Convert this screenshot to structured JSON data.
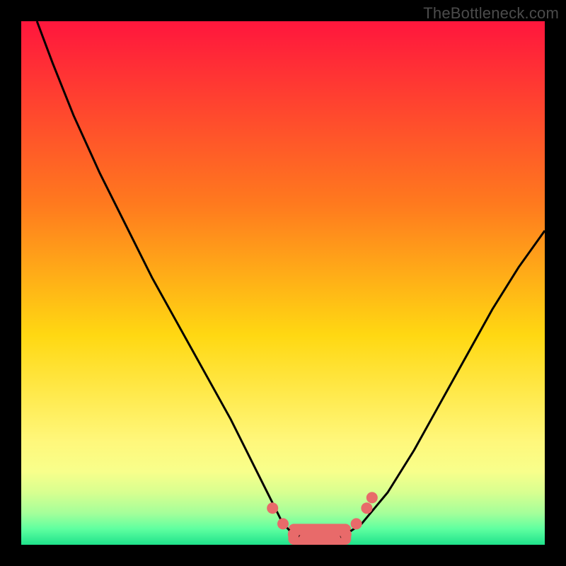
{
  "watermark": {
    "text": "TheBottleneck.com"
  },
  "colors": {
    "bgTop": "#ff163d",
    "bgMidUpper": "#ff7a1e",
    "bgMid": "#ffd812",
    "bgLow1": "#fff77a",
    "bgLow2": "#f8ff8b",
    "bgLow3": "#d8ff90",
    "bgLow4": "#a4ff9a",
    "bgLow5": "#5effa0",
    "bgBottom": "#1fe28b",
    "curve": "#000000",
    "marker": "#e86a6a"
  },
  "chart_data": {
    "type": "line",
    "title": "",
    "xlabel": "",
    "ylabel": "",
    "xlim": [
      0,
      100
    ],
    "ylim": [
      0,
      100
    ],
    "grid": false,
    "series": [
      {
        "name": "bottleneck-curve",
        "x": [
          3,
          6,
          10,
          15,
          20,
          25,
          30,
          35,
          40,
          45,
          48,
          50,
          52,
          55,
          58,
          60,
          62,
          65,
          70,
          75,
          80,
          85,
          90,
          95,
          100
        ],
        "y": [
          100,
          92,
          82,
          71,
          61,
          51,
          42,
          33,
          24,
          14,
          8,
          4,
          2,
          1,
          1,
          1,
          2,
          4,
          10,
          18,
          27,
          36,
          45,
          53,
          60
        ]
      }
    ],
    "markers": [
      {
        "x": 48,
        "y": 7
      },
      {
        "x": 50,
        "y": 4
      },
      {
        "x": 52,
        "y": 2
      },
      {
        "x": 54,
        "y": 1
      },
      {
        "x": 56,
        "y": 1
      },
      {
        "x": 58,
        "y": 1
      },
      {
        "x": 60,
        "y": 1
      },
      {
        "x": 62,
        "y": 2
      },
      {
        "x": 64,
        "y": 4
      },
      {
        "x": 66,
        "y": 7
      },
      {
        "x": 67,
        "y": 9
      }
    ],
    "valley_band": {
      "x0": 51,
      "x1": 63,
      "y": 1,
      "height": 3
    }
  }
}
